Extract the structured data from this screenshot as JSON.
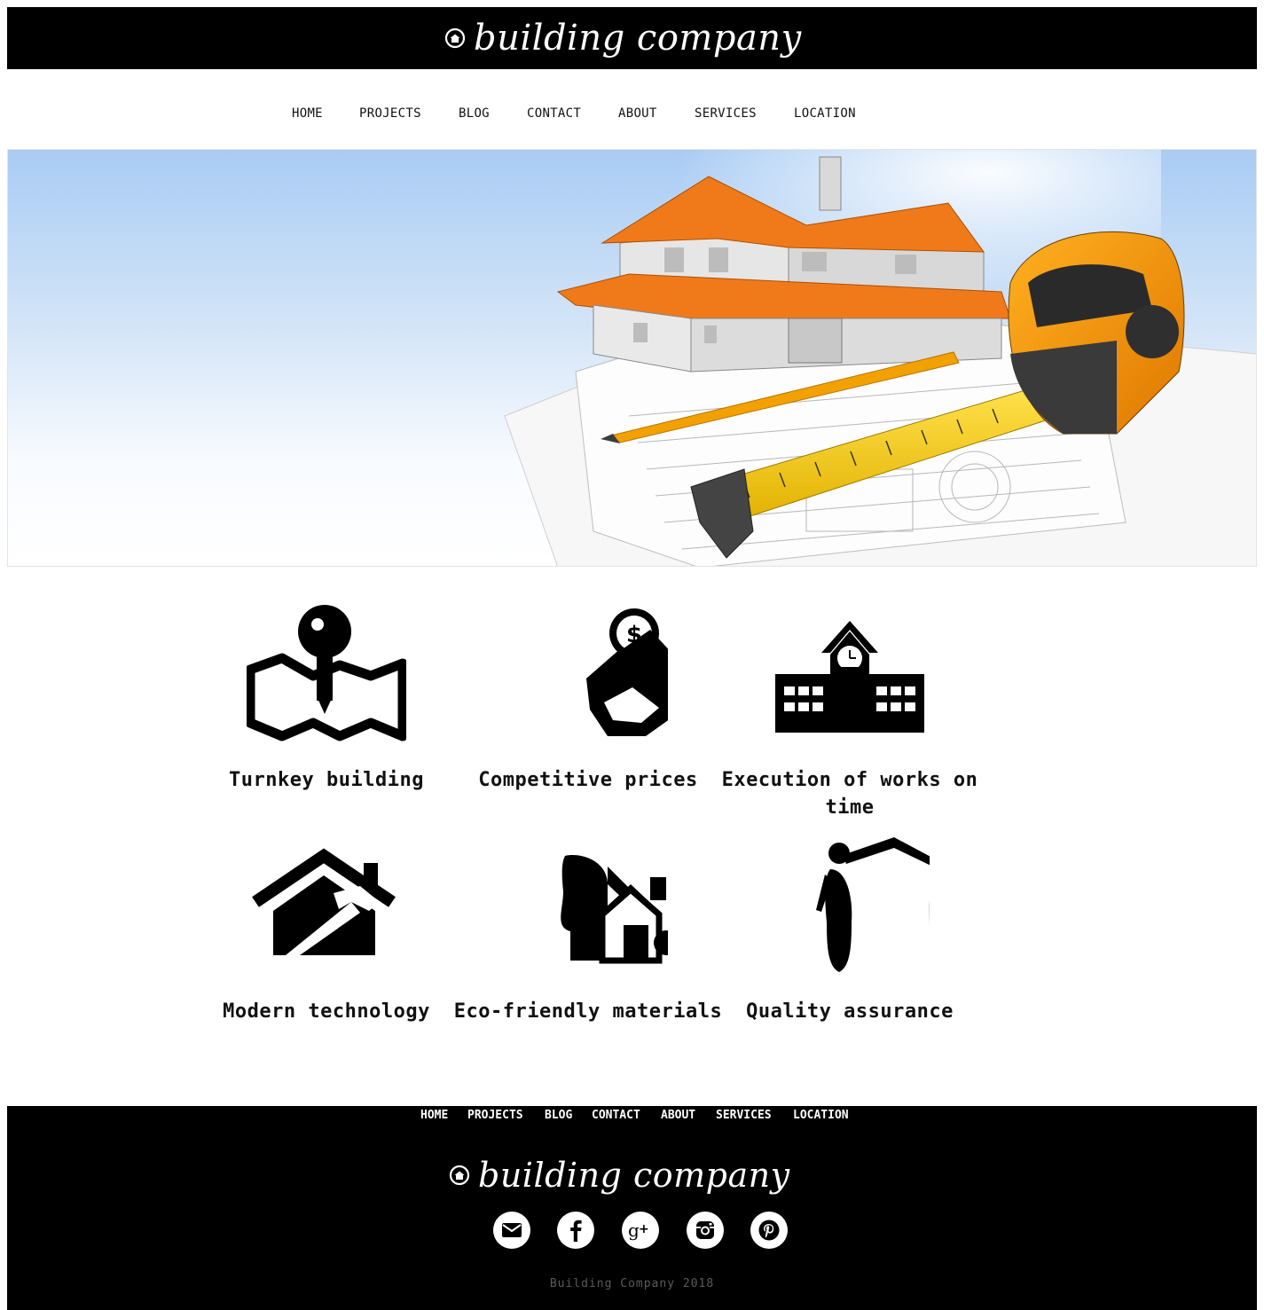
{
  "brand": {
    "name": "building company"
  },
  "nav": [
    {
      "label": "HOME"
    },
    {
      "label": "PROJECTS"
    },
    {
      "label": "BLOG"
    },
    {
      "label": "CONTACT"
    },
    {
      "label": "ABOUT"
    },
    {
      "label": "SERVICES"
    },
    {
      "label": "LOCATION"
    }
  ],
  "features": [
    {
      "title": "Turnkey building",
      "icon": "key-map-icon"
    },
    {
      "title": "Competitive prices",
      "icon": "house-coin-icon"
    },
    {
      "title": "Execution of works on time",
      "icon": "school-clock-icon"
    },
    {
      "title": "Modern technology",
      "icon": "house-hammer-icon"
    },
    {
      "title": "Eco-friendly materials",
      "icon": "eco-house-icon"
    },
    {
      "title": "Quality assurance",
      "icon": "people-roof-icon"
    }
  ],
  "hero": {
    "image": "house-model-with-tape-measure-on-blueprints"
  },
  "social": [
    {
      "name": "email-icon"
    },
    {
      "name": "facebook-icon"
    },
    {
      "name": "google-plus-icon"
    },
    {
      "name": "instagram-icon"
    },
    {
      "name": "pinterest-icon"
    }
  ],
  "footer": {
    "copyright": "Building Company 2018"
  },
  "colors": {
    "header_bg": "#000000",
    "roof": "#f07a1a",
    "tape": "#f5c800",
    "sky": "#a9ccf4"
  }
}
